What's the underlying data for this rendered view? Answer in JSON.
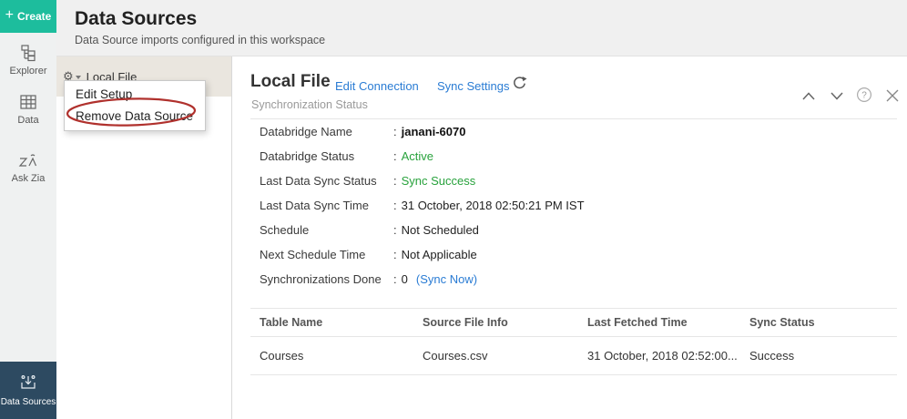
{
  "create": {
    "plus": "+",
    "label": "Create"
  },
  "sidebar": {
    "items": [
      {
        "label": "Explorer"
      },
      {
        "label": "Data"
      },
      {
        "label": "Ask Zia"
      }
    ],
    "active": {
      "label": "Data Sources"
    }
  },
  "header": {
    "title": "Data Sources",
    "subtitle": "Data Source imports configured in this workspace"
  },
  "source_list": {
    "selected_label": "Local File"
  },
  "context_menu": {
    "items": [
      {
        "label": "Edit Setup"
      },
      {
        "label": "Remove Data Source"
      }
    ]
  },
  "detail": {
    "title": "Local File",
    "links": [
      {
        "label": "Edit Connection"
      },
      {
        "label": "Sync Settings"
      }
    ],
    "section_label": "Synchronization Status",
    "colon": ":",
    "rows": [
      {
        "label": "Databridge Name",
        "value": "janani-6070"
      },
      {
        "label": "Databridge Status",
        "value": "Active"
      },
      {
        "label": "Last Data Sync Status",
        "value": "Sync Success"
      },
      {
        "label": "Last Data Sync Time",
        "value": "31 October, 2018 02:50:21 PM IST"
      },
      {
        "label": "Schedule",
        "value": "Not Scheduled"
      },
      {
        "label": "Next Schedule Time",
        "value": "Not Applicable"
      },
      {
        "label": "Synchronizations Done",
        "value": "0",
        "link": "(Sync Now)"
      }
    ],
    "help_glyph": "?"
  },
  "table": {
    "headers": [
      "Table Name",
      "Source File Info",
      "Last Fetched Time",
      "Sync Status"
    ],
    "rows": [
      {
        "table_name": "Courses",
        "source_file": "Courses.csv",
        "last_fetched": "31 October, 2018 02:52:00...",
        "sync_status": "Success"
      }
    ]
  },
  "colors": {
    "accent_teal": "#1dbd9d",
    "navy": "#2d4a61",
    "link_blue": "#2a7cd4",
    "success_green": "#28a23c",
    "annotation_red": "#b0312d",
    "selected_row_beige": "#eae6df"
  },
  "gear_glyph": "⚙"
}
